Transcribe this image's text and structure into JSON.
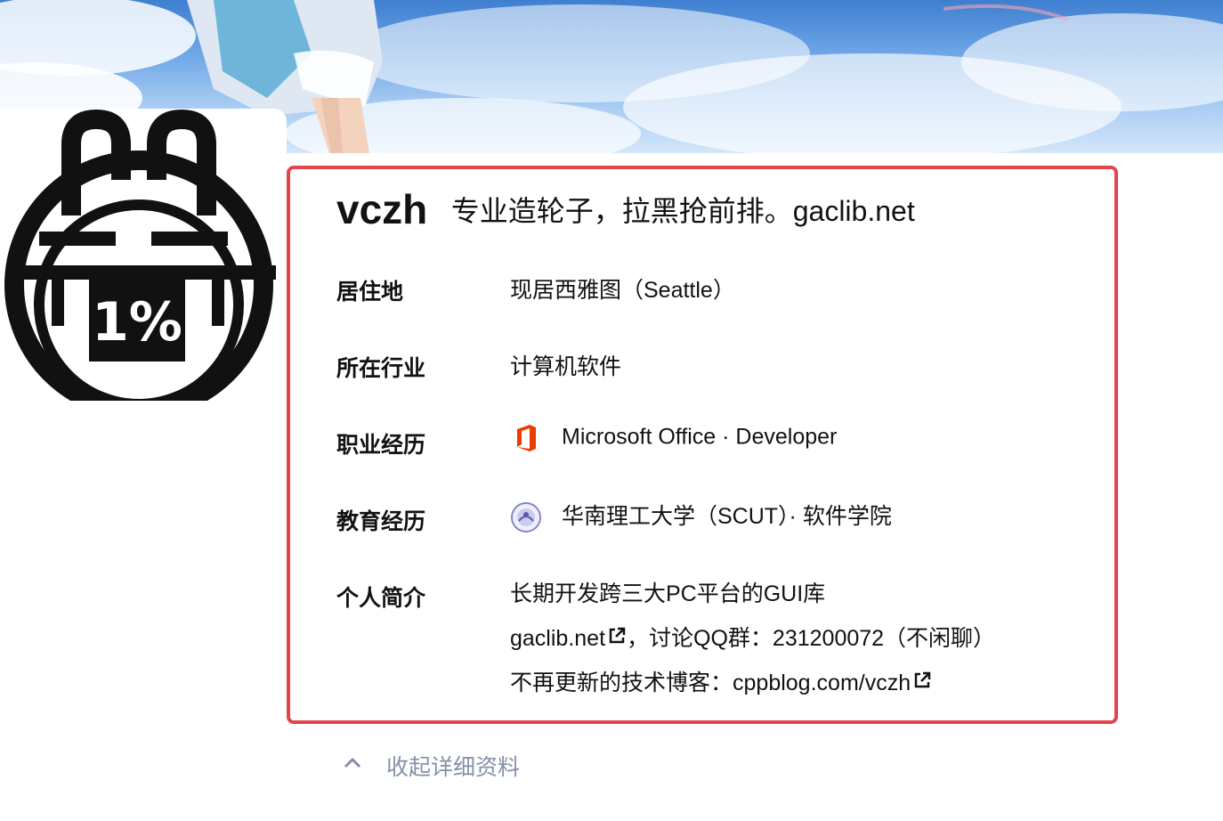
{
  "profile": {
    "name": "vczh",
    "headline": "专业造轮子，拉黑抢前排。gaclib.net",
    "avatar_text": "1%"
  },
  "details": [
    {
      "label": "居住地",
      "value": "现居西雅图（Seattle）",
      "icon": ""
    },
    {
      "label": "所在行业",
      "value": "计算机软件",
      "icon": ""
    },
    {
      "label": "职业经历",
      "value": "Microsoft Office · Developer",
      "icon": "office-logo-icon"
    },
    {
      "label": "教育经历",
      "value": "华南理工大学（SCUT）· 软件学院",
      "icon": "scut-logo-icon"
    }
  ],
  "bio": {
    "label": "个人简介",
    "line1": "长期开发跨三大PC平台的GUI库",
    "line2_link": "gaclib.net",
    "line2_rest": "，讨论QQ群：231200072（不闲聊）",
    "line3_prefix": "不再更新的技术博客：",
    "line3_link": "cppblog.com/vczh"
  },
  "collapse_label": "收起详细资料",
  "colors": {
    "highlight_border": "#e3454b",
    "office_orange": "#eb3c00",
    "muted_text": "#8590a6"
  }
}
